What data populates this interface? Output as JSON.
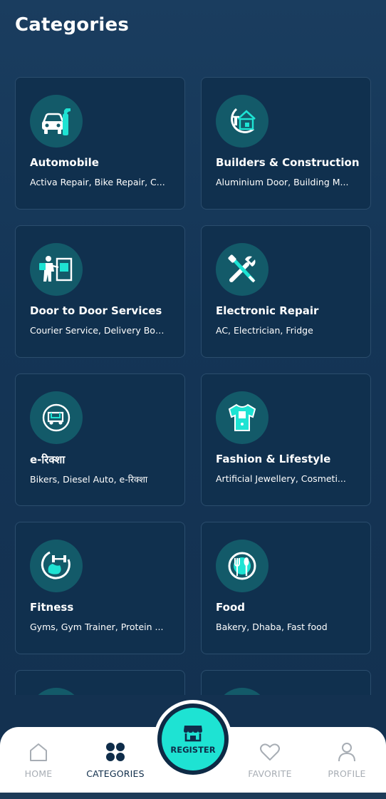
{
  "page": {
    "title": "Categories"
  },
  "categories": [
    {
      "name": "Automobile",
      "subtitle": "Activa Repair, Bike Repair, C...",
      "icon": "car-repair-icon"
    },
    {
      "name": "Builders & Construction",
      "subtitle": "Aluminium Door, Building M...",
      "icon": "construction-icon"
    },
    {
      "name": "Door to Door Services",
      "subtitle": "Courier Service, Delivery Boy...",
      "icon": "delivery-icon"
    },
    {
      "name": "Electronic Repair",
      "subtitle": "AC, Electrician, Fridge",
      "icon": "electronic-repair-icon"
    },
    {
      "name": "e-रिक्शा",
      "subtitle": "Bikers, Diesel Auto, e-रिक्शा",
      "icon": "rickshaw-icon"
    },
    {
      "name": "Fashion & Lifestyle",
      "subtitle": "Artificial Jewellery, Cosmeti...",
      "icon": "tshirt-icon"
    },
    {
      "name": "Fitness",
      "subtitle": "Gyms, Gym Trainer, Protein ...",
      "icon": "fitness-icon"
    },
    {
      "name": "Food",
      "subtitle": "Bakery, Dhaba, Fast food",
      "icon": "food-icon"
    }
  ],
  "nav": {
    "home": "HOME",
    "categories": "CATEGORIES",
    "register": "REGISTER",
    "favorite": "FAVORITE",
    "profile": "PROFILE",
    "active": "categories"
  },
  "colors": {
    "accent": "#1ee3d3",
    "card_bg": "#10304e",
    "icon_circle": "#135a69",
    "page_bg": "#163a5b"
  }
}
